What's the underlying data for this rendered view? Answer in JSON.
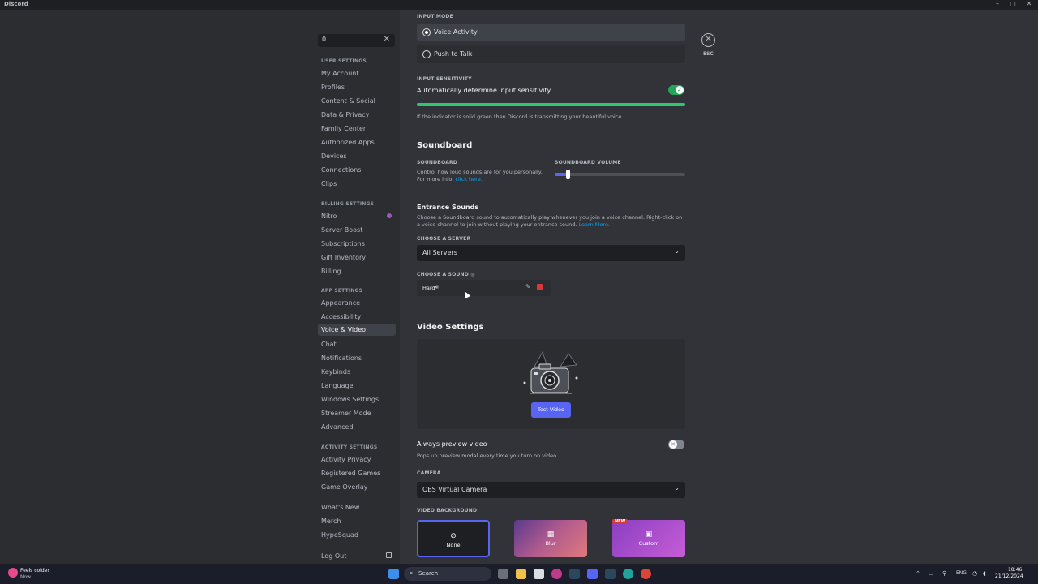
{
  "window": {
    "title": "Discord"
  },
  "search": {
    "value": "0"
  },
  "sidebar": {
    "user_settings_header": "USER SETTINGS",
    "user_items": [
      "My Account",
      "Profiles",
      "Content & Social",
      "Data & Privacy",
      "Family Center",
      "Authorized Apps",
      "Devices",
      "Connections",
      "Clips"
    ],
    "billing_header": "BILLING SETTINGS",
    "billing_items": [
      "Nitro",
      "Server Boost",
      "Subscriptions",
      "Gift Inventory",
      "Billing"
    ],
    "app_header": "APP SETTINGS",
    "app_items": [
      "Appearance",
      "Accessibility",
      "Voice & Video",
      "Chat",
      "Notifications",
      "Keybinds",
      "Language",
      "Windows Settings",
      "Streamer Mode",
      "Advanced"
    ],
    "activity_header": "ACTIVITY SETTINGS",
    "activity_items": [
      "Activity Privacy",
      "Registered Games",
      "Game Overlay"
    ],
    "misc_items": [
      "What's New",
      "Merch",
      "HypeSquad"
    ],
    "logout": "Log Out"
  },
  "esc": "ESC",
  "input_mode": {
    "label": "INPUT MODE",
    "options": [
      "Voice Activity",
      "Push to Talk"
    ],
    "selected": "Voice Activity"
  },
  "input_sensitivity": {
    "label": "INPUT SENSITIVITY",
    "auto_label": "Automatically determine input sensitivity",
    "auto_on": true,
    "help": "If the indicator is solid green then Discord is transmitting your beautiful voice."
  },
  "soundboard": {
    "title": "Soundboard",
    "label": "SOUNDBOARD",
    "desc": "Control how loud sounds are for you personally. For more info,",
    "link": "click here.",
    "volume_label": "SOUNDBOARD VOLUME",
    "volume": 0.1
  },
  "entrance": {
    "title": "Entrance Sounds",
    "desc": "Choose a Soundboard sound to automatically play whenever you join a voice channel. Right-click on a voice channel to join without playing your entrance sound.",
    "link": "Learn More.",
    "server_label": "CHOOSE A SERVER",
    "server_value": "All Servers",
    "sound_label": "CHOOSE A SOUND",
    "sound_name": "Hard"
  },
  "video": {
    "title": "Video Settings",
    "test_button": "Test Video",
    "preview_label": "Always preview video",
    "preview_desc": "Pops up preview modal every time you turn on video",
    "preview_on": false,
    "camera_label": "CAMERA",
    "camera_value": "OBS Virtual Camera",
    "bg_label": "VIDEO BACKGROUND",
    "bg_options": [
      "None",
      "Blur",
      "Custom"
    ],
    "new_badge": "NEW"
  },
  "taskbar": {
    "weather": "Feels colder",
    "weather_sub": "Now",
    "search": "Search",
    "lang": "ENG",
    "time": "18:46",
    "date": "21/12/2024"
  },
  "colors": {
    "accent": "#5865f2",
    "green": "#23a55a",
    "meter": "#2dc770"
  }
}
